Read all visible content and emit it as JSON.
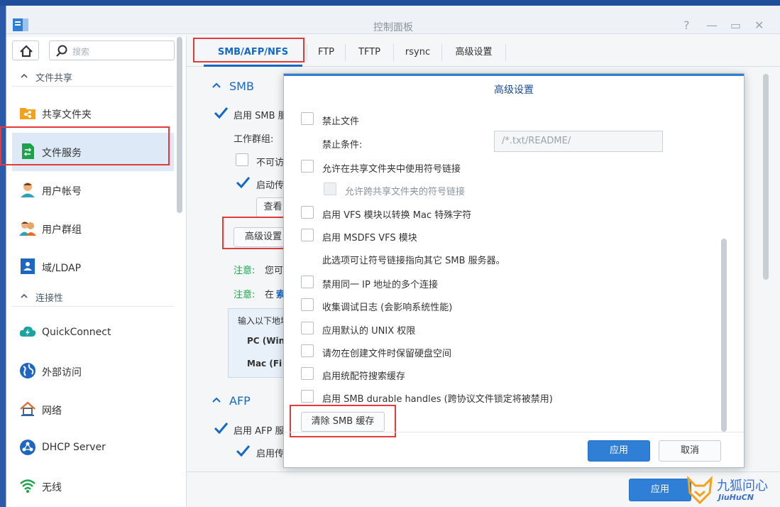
{
  "window": {
    "title": "控制面板",
    "controls": [
      "?",
      "—",
      "▭",
      "✕"
    ]
  },
  "sidebar": {
    "search_placeholder": "搜索",
    "section_file_sharing": "文件共享",
    "section_connectivity": "连接性",
    "items": [
      {
        "label": "共享文件夹",
        "icon": "shared-folder-icon"
      },
      {
        "label": "文件服务",
        "icon": "file-services-icon"
      },
      {
        "label": "用户帐号",
        "icon": "user-icon"
      },
      {
        "label": "用户群组",
        "icon": "group-icon"
      },
      {
        "label": "域/LDAP",
        "icon": "domain-ldap-icon"
      },
      {
        "label": "QuickConnect",
        "icon": "quickconnect-icon"
      },
      {
        "label": "外部访问",
        "icon": "globe-icon"
      },
      {
        "label": "网络",
        "icon": "network-icon"
      },
      {
        "label": "DHCP Server",
        "icon": "dhcp-icon"
      },
      {
        "label": "无线",
        "icon": "wifi-icon"
      }
    ]
  },
  "tabs": [
    "SMB/AFP/NFS",
    "FTP",
    "TFTP",
    "rsync",
    "高级设置"
  ],
  "main": {
    "smb_section": "SMB",
    "enable_smb": "启用 SMB 服",
    "workgroup": "工作群组:",
    "hide_text": "不可访问",
    "enable_transfer_log": "启动传输",
    "view_log_btn": "查看日",
    "advanced_btn": "高级设置",
    "note1_label": "注意:",
    "note1_text": "您可启",
    "note2_label": "注意:",
    "note2_text": "在",
    "note2_link": "索引",
    "info_line1": "输入以下地址",
    "info_line2": "PC (Win",
    "info_line3": "Mac (Fi",
    "afp_section": "AFP",
    "enable_afp": "启用 AFP 服务",
    "enable_afp_transfer": "启用传输",
    "apply_btn": "应用"
  },
  "dialog": {
    "title": "高级设置",
    "ban_files": "禁止文件",
    "ban_condition_label": "禁止条件:",
    "ban_condition_value": "/*.txt/README/",
    "allow_symlink": "允许在共享文件夹中使用符号链接",
    "allow_cross_symlink": "允许跨共享文件夹的符号链接",
    "vfs_mac": "启用 VFS 模块以转换 Mac 特殊字符",
    "msdfs": "启用 MSDFS VFS 模块",
    "msdfs_note": "此选项可让符号链接指向其它 SMB 服务器。",
    "disable_multi_ip": "禁用同一 IP 地址的多个连接",
    "collect_debug": "收集调试日志 (会影响系统性能)",
    "default_unix": "应用默认的 UNIX 权限",
    "no_reserve": "请勿在创建文件时保留硬盘空间",
    "wildcard_cache": "启用统配符搜索缓存",
    "durable_handles": "启用 SMB durable handles (跨协议文件锁定将被禁用)",
    "clear_cache_btn": "清除 SMB 缓存",
    "apply_btn": "应用",
    "cancel_btn": "取消"
  },
  "watermark": {
    "brand_cn": "九狐问心",
    "brand_en": "JiuHuCN"
  },
  "colors": {
    "accent": "#2f7fd6",
    "highlight": "#e23b3b",
    "note": "#1aa34a"
  }
}
